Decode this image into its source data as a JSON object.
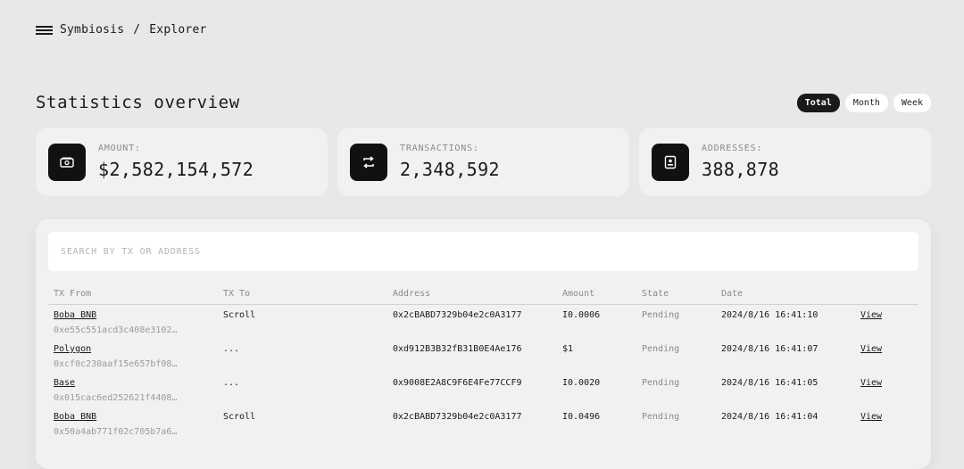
{
  "breadcrumb": {
    "root": "Symbiosis",
    "separator": "/",
    "current": "Explorer"
  },
  "page_title": "Statistics overview",
  "periods": [
    {
      "label": "Total",
      "active": true
    },
    {
      "label": "Month",
      "active": false
    },
    {
      "label": "Week",
      "active": false
    }
  ],
  "stats": [
    {
      "icon": "money-icon",
      "label": "AMOUNT:",
      "value": "$2,582,154,572"
    },
    {
      "icon": "repeat-icon",
      "label": "TRANSACTIONS:",
      "value": "2,348,592"
    },
    {
      "icon": "address-book-icon",
      "label": "ADDRESSES:",
      "value": "388,878"
    }
  ],
  "search": {
    "placeholder": "SEARCH BY TX OR ADDRESS",
    "value": ""
  },
  "table": {
    "headers": [
      "TX From",
      "TX To",
      "Address",
      "Amount",
      "State",
      "Date",
      ""
    ],
    "rows": [
      {
        "from_chain": "Boba BNB",
        "from_hash": "0xe55c551acd3c408e3102…",
        "to": "Scroll",
        "address": "0x2cBABD7329b04e2c0A3177",
        "amount": "Ι0.0006",
        "state": "Pending",
        "date": "2024/8/16 16:41:10",
        "action": "View"
      },
      {
        "from_chain": "Polygon",
        "from_hash": "0xcf0c230aaf15e657bf08…",
        "to": "...",
        "address": "0xd912B3B32fB31B0E4Ae176",
        "amount": "$1",
        "state": "Pending",
        "date": "2024/8/16 16:41:07",
        "action": "View"
      },
      {
        "from_chain": "Base",
        "from_hash": "0x015cac6ed252621f4408…",
        "to": "...",
        "address": "0x9008E2A8C9F6E4Fe77CCF9",
        "amount": "Ι0.0020",
        "state": "Pending",
        "date": "2024/8/16 16:41:05",
        "action": "View"
      },
      {
        "from_chain": "Boba BNB",
        "from_hash": "0x50a4ab771f02c705b7a6…",
        "to": "Scroll",
        "address": "0x2cBABD7329b04e2c0A3177",
        "amount": "Ι0.0496",
        "state": "Pending",
        "date": "2024/8/16 16:41:04",
        "action": "View"
      }
    ]
  }
}
